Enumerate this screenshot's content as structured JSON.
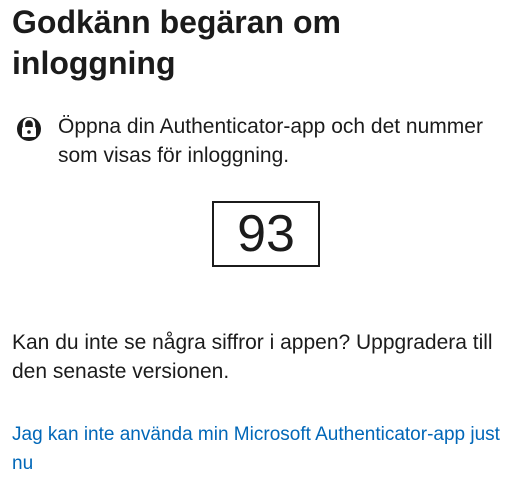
{
  "page": {
    "title": "Godkänn begäran om inloggning",
    "instruction": "Öppna din Authenticator-app och det nummer som visas för inloggning.",
    "number": "93",
    "upgrade_text": "Kan du inte se några siffror i appen? Uppgradera till den senaste versionen.",
    "cant_use_link": "Jag kan inte använda min Microsoft Authenticator-app just nu"
  },
  "icons": {
    "instruction_icon": "lock-icon"
  },
  "colors": {
    "text": "#1b1b1b",
    "link": "#0067b8",
    "background": "#ffffff"
  }
}
